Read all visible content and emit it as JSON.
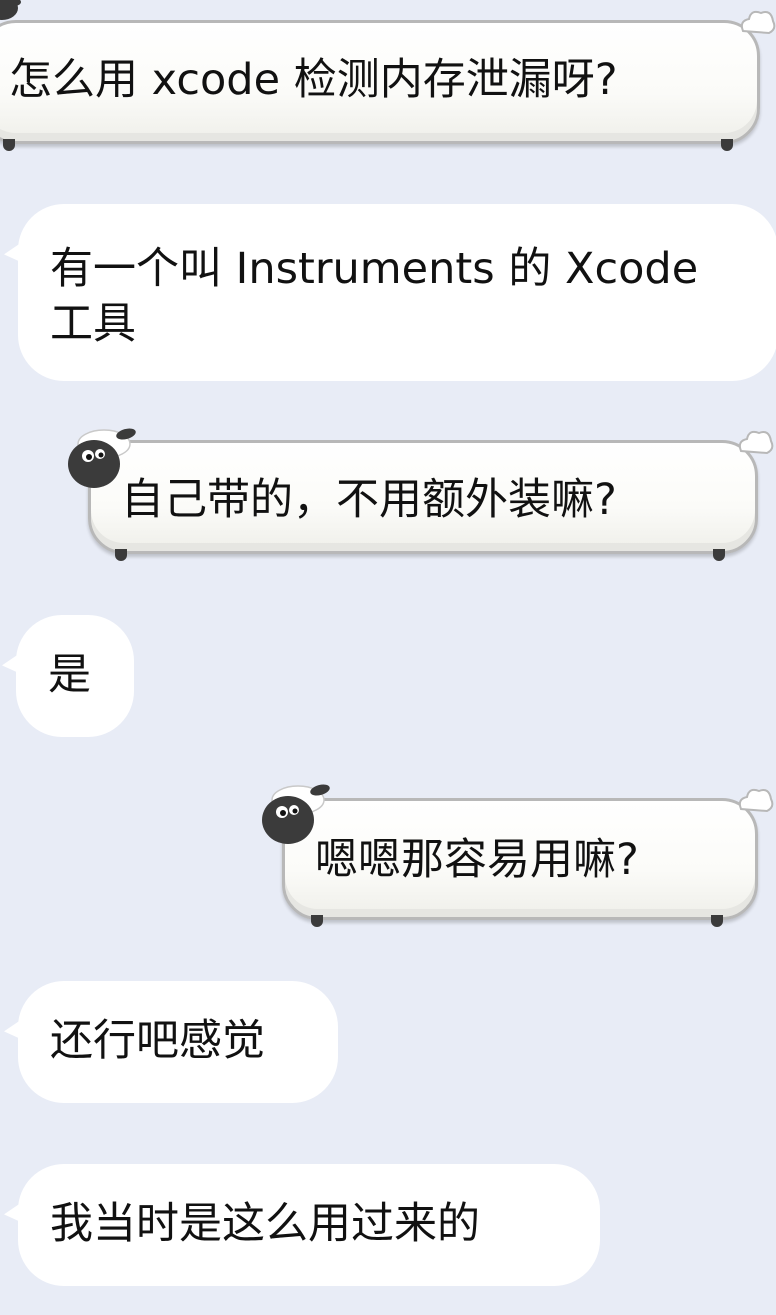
{
  "messages": [
    {
      "from": "me",
      "text": "怎么用 xcode 检测内存泄漏呀?"
    },
    {
      "from": "other",
      "text": "有一个叫 Instruments 的 Xcode\n工具"
    },
    {
      "from": "me",
      "text": "自己带的，不用额外装嘛?"
    },
    {
      "from": "other",
      "text": "是"
    },
    {
      "from": "me",
      "text": "嗯嗯那容易用嘛?"
    },
    {
      "from": "other",
      "text": "还行吧感觉"
    },
    {
      "from": "other",
      "text": "我当时是这么用过来的"
    }
  ],
  "icons": {
    "avatar": "sheep-head-icon",
    "tuft": "cloud-tuft-icon"
  },
  "colors": {
    "background": "#e8ecf6",
    "incoming_bubble": "#ffffff",
    "outgoing_bubble_border": "#b8b8b8"
  }
}
